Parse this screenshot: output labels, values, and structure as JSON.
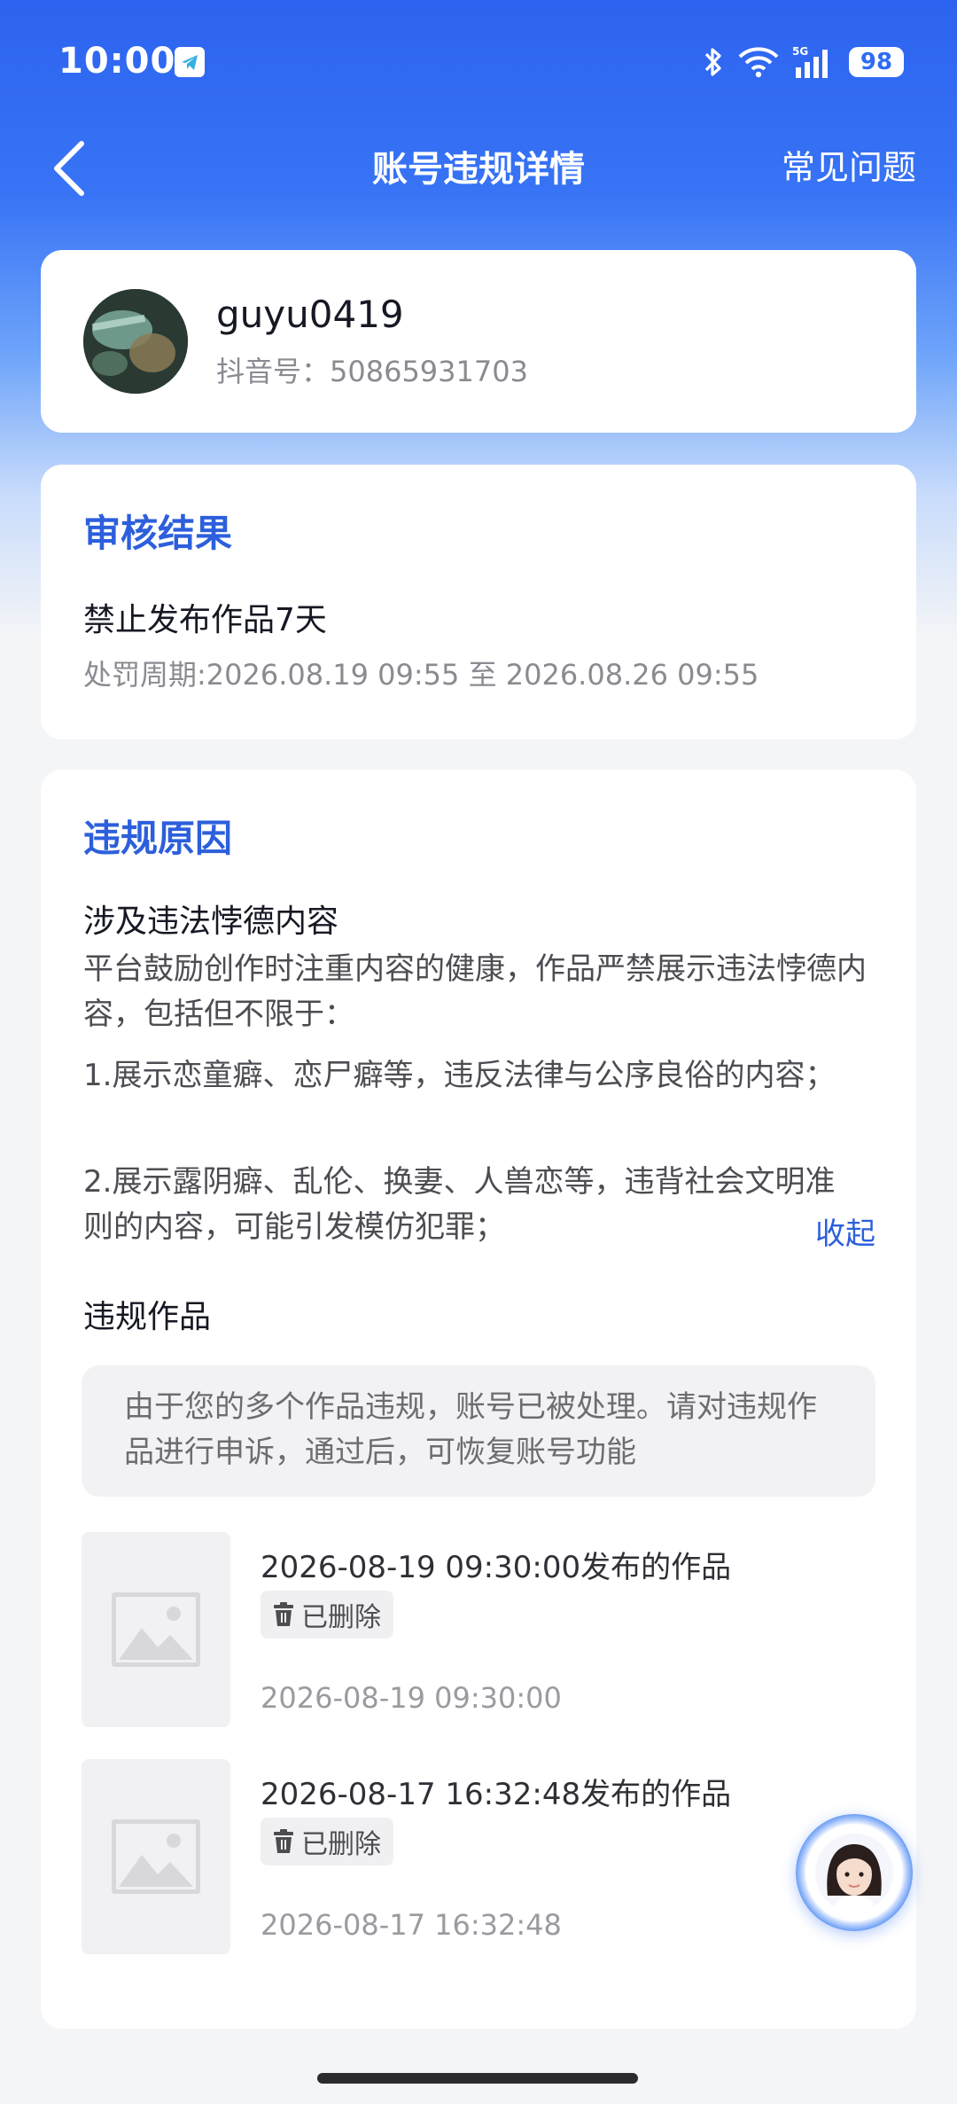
{
  "status_bar": {
    "time": "10:00",
    "battery": "98",
    "network": "5G"
  },
  "nav": {
    "title": "账号违规详情",
    "faq": "常见问题"
  },
  "profile": {
    "username": "guyu0419",
    "douyin_id": "抖音号：50865931703"
  },
  "review_result": {
    "section_title": "审核结果",
    "penalty": "禁止发布作品7天",
    "period": "处罚周期:2026.08.19 09:55 至 2026.08.26 09:55"
  },
  "violation_reason": {
    "section_title": "违规原因",
    "heading": "涉及违法悖德内容",
    "intro": "平台鼓励创作时注重内容的健康，作品严禁展示违法悖德内容，包括但不限于：",
    "item1": "1.展示恋童癖、恋尸癖等，违反法律与公序良俗的内容；",
    "item2": "2.展示露阴癖、乱伦、换妻、人兽恋等，违背社会文明准则的内容，可能引发模仿犯罪；",
    "collapse_label": "收起"
  },
  "violating_works": {
    "title": "违规作品",
    "notice": "由于您的多个作品违规，账号已被处理。请对违规作品进行申诉，通过后，可恢复账号功能",
    "items": [
      {
        "title": "2026-08-19 09:30:00发布的作品",
        "status": "已删除",
        "time": "2026-08-19 09:30:00"
      },
      {
        "title": "2026-08-17 16:32:48发布的作品",
        "status": "已删除",
        "time": "2026-08-17 16:32:48"
      }
    ]
  },
  "colors": {
    "header_blue": "#2c63f0",
    "accent_blue": "#2c5fdc",
    "text_dark": "#161823",
    "text_gray": "#8a8b91"
  }
}
